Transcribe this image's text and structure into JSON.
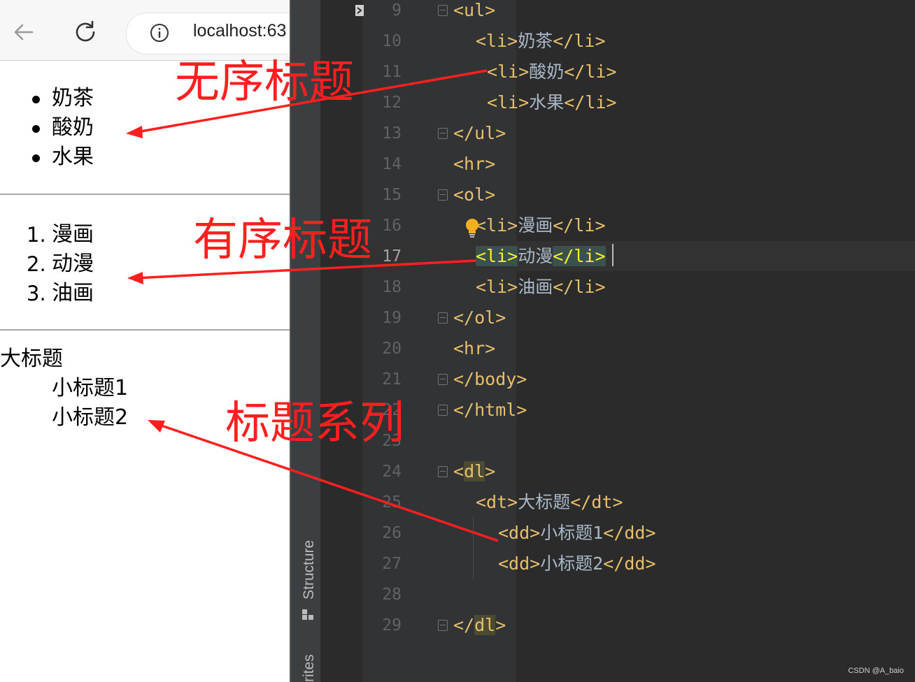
{
  "browser": {
    "url": "localhost:63",
    "unordered_list": [
      "奶茶",
      "酸奶",
      "水果"
    ],
    "ordered_list": [
      {
        "number": "1.",
        "text": "漫画"
      },
      {
        "number": "2.",
        "text": "动漫"
      },
      {
        "number": "3.",
        "text": "油画"
      }
    ],
    "definition_list": {
      "term": "大标题",
      "descriptions": [
        "小标题1",
        "小标题2"
      ]
    }
  },
  "annotations": {
    "unordered": "无序标题",
    "ordered": "有序标题",
    "definition": "标题系列",
    "color": "#ff1f1f"
  },
  "ide": {
    "side_tabs": {
      "structure": "Structure",
      "favorites": "rites"
    },
    "line_numbers": [
      "9",
      "10",
      "11",
      "12",
      "13",
      "14",
      "15",
      "16",
      "17",
      "18",
      "19",
      "20",
      "21",
      "22",
      "23",
      "24",
      "25",
      "26",
      "27",
      "28",
      "29"
    ],
    "code": {
      "l9": "<ul>",
      "l10_open": "<li>",
      "l10_text": "奶茶",
      "l10_close": "</li>",
      "l11_open": "<li>",
      "l11_text": "酸奶",
      "l11_close": "</li>",
      "l12_open": "<li>",
      "l12_text": "水果",
      "l12_close": "</li>",
      "l13": "</ul>",
      "l14": "<hr>",
      "l15": "<ol>",
      "l16_open": "<li>",
      "l16_text": "漫画",
      "l16_close": "</li>",
      "l17_open": "<li>",
      "l17_text": "动漫",
      "l17_close": "</li>",
      "l18_open": "<li>",
      "l18_text": "油画",
      "l18_close": "</li>",
      "l19": "</ol>",
      "l20": "<hr>",
      "l21": "</body>",
      "l22": "</html>",
      "l24_a": "<",
      "l24_b": "dl",
      "l24_c": ">",
      "l25_open": "<dt>",
      "l25_text": "大标题",
      "l25_close": "</dt>",
      "l26_open": "<dd>",
      "l26_text": "小标题1",
      "l26_close": "</dd>",
      "l27_open": "<dd>",
      "l27_text": "小标题2",
      "l27_close": "</dd>",
      "l29_a": "</",
      "l29_b": "dl",
      "l29_c": ">"
    }
  },
  "watermark": "CSDN @A_baio"
}
